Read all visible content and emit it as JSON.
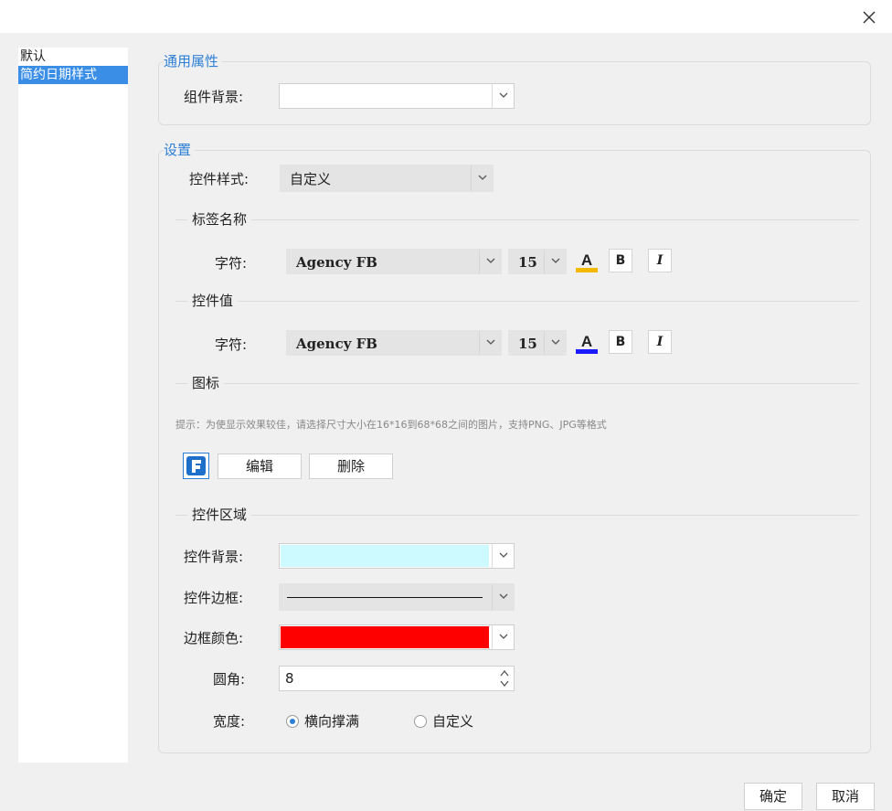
{
  "window": {
    "close_icon": "close-icon"
  },
  "style_list": {
    "items": [
      "默认",
      "简约日期样式"
    ],
    "selected_index": 1
  },
  "general": {
    "title": "通用属性",
    "component_bg_label": "组件背景:",
    "component_bg_value": ""
  },
  "settings": {
    "title": "设置",
    "control_style_label": "控件样式:",
    "control_style_value": "自定义",
    "tag_name": {
      "title": "标签名称",
      "font_label": "字符:",
      "font_value": "Agency FB",
      "size_value": "15",
      "font_color": "#f5b800",
      "bold_label": "B",
      "italic_label": "I"
    },
    "control_value": {
      "title": "控件值",
      "font_label": "字符:",
      "font_value": "Agency FB",
      "size_value": "15",
      "font_color": "#1a1aff",
      "bold_label": "B",
      "italic_label": "I"
    },
    "icon": {
      "title": "图标",
      "hint": "提示：为使显示效果较佳，请选择尺寸大小在16*16到68*68之间的图片，支持PNG、JPG等格式",
      "edit_label": "编辑",
      "delete_label": "删除"
    },
    "area": {
      "title": "控件区域",
      "bg_label": "控件背景:",
      "bg_color": "#ccfaff",
      "border_label": "控件边框:",
      "border_color_label": "边框颜色:",
      "border_color": "#ff0000",
      "radius_label": "圆角:",
      "radius_value": "8",
      "width_label": "宽度:",
      "width_options": [
        "横向撑满",
        "自定义"
      ],
      "width_selected": 0
    }
  },
  "footer": {
    "ok_label": "确定",
    "cancel_label": "取消"
  }
}
